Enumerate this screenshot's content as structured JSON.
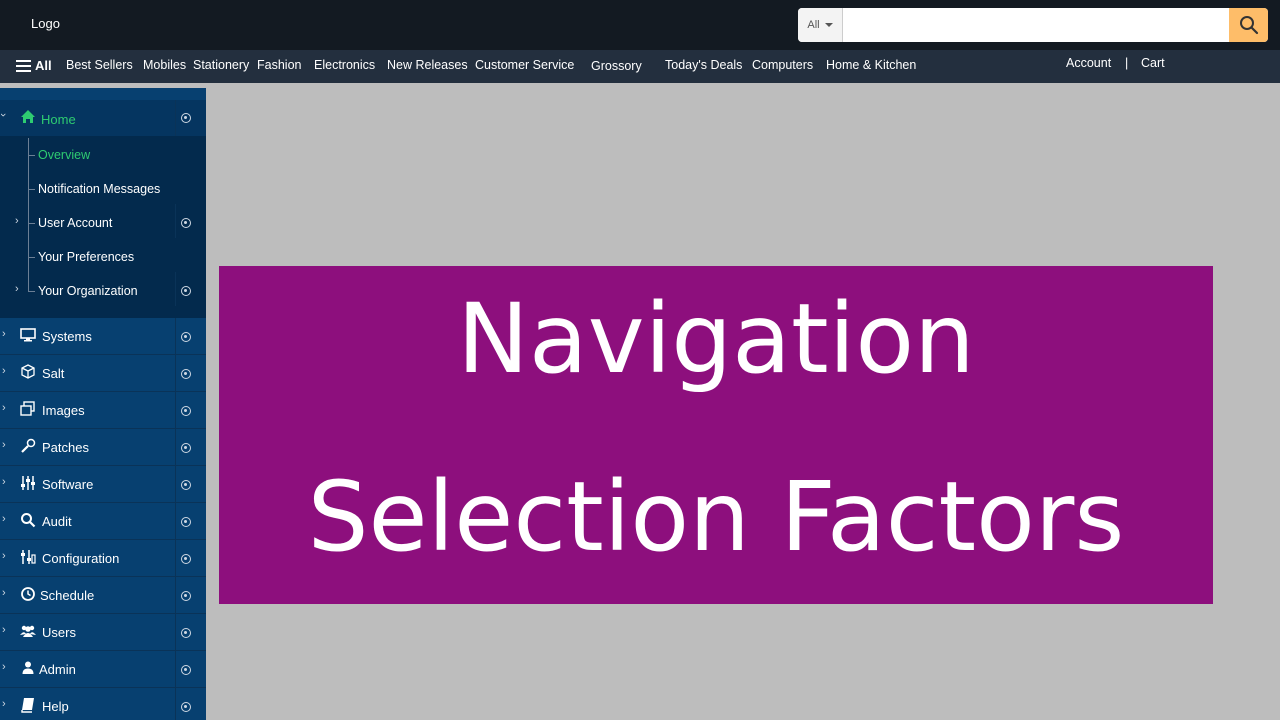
{
  "header": {
    "logo": "Logo",
    "search": {
      "category": "All",
      "placeholder": ""
    }
  },
  "navbar": {
    "all_label": "All",
    "items": [
      "Best Sellers",
      "Mobiles",
      "Stationery",
      "Fashion",
      "Electronics",
      "New Releases",
      "Customer Service",
      "Grossory",
      "Today's Deals",
      "Computers",
      "Home & Kitchen"
    ],
    "account": "Account",
    "separator": "|",
    "cart": "Cart"
  },
  "sidebar": {
    "home": {
      "label": "Home",
      "subitems": [
        "Overview",
        "Notification Messages",
        "User Account",
        "Your Preferences",
        "Your Organization"
      ]
    },
    "items": [
      {
        "label": "Systems",
        "icon": "monitor-icon"
      },
      {
        "label": "Salt",
        "icon": "cube-icon"
      },
      {
        "label": "Images",
        "icon": "images-icon"
      },
      {
        "label": "Patches",
        "icon": "patches-icon"
      },
      {
        "label": "Software",
        "icon": "sliders-icon"
      },
      {
        "label": "Audit",
        "icon": "search-icon"
      },
      {
        "label": "Configuration",
        "icon": "config-icon"
      },
      {
        "label": "Schedule",
        "icon": "clock-icon"
      },
      {
        "label": "Users",
        "icon": "users-icon"
      },
      {
        "label": "Admin",
        "icon": "user-icon"
      },
      {
        "label": "Help",
        "icon": "book-icon"
      }
    ]
  },
  "banner": {
    "line1": "Navigation",
    "line2": "Selection Factors"
  },
  "colors": {
    "topbar": "#131a22",
    "navbar": "#232f3e",
    "search_button": "#febd69",
    "sidebar": "#074070",
    "active_green": "#2ecc71",
    "banner": "#8d0f7d",
    "background": "#bdbdbd"
  }
}
